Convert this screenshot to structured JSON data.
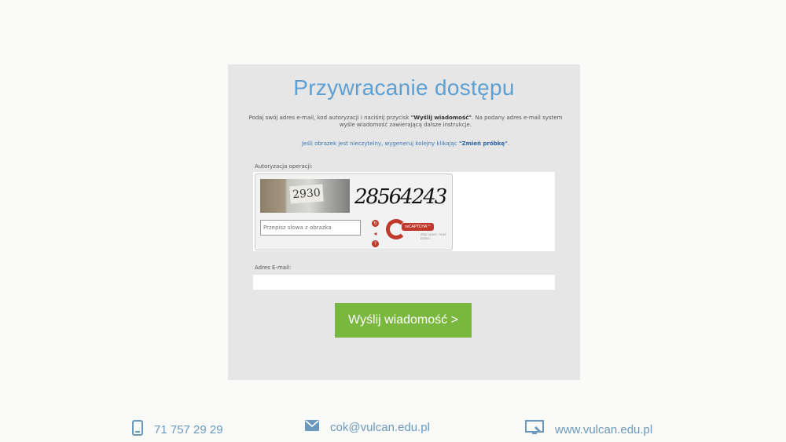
{
  "form": {
    "title": "Przywracanie dostępu",
    "instruction_prefix": "Podaj swój adres e-mail, kod autoryzacji i naciśnij przycisk ",
    "instruction_button_ref": "\"Wyślij wiadomość\"",
    "instruction_suffix": ". Na podany adres e-mail system wyśle wiadomość zawierającą dalsze instrukcje.",
    "hint_prefix": "Jeśli obrazek jest nieczytelny, wygeneruj kolejny klikając ",
    "hint_link": "\"Zmień próbkę\"",
    "hint_suffix": ".",
    "auth_label": "Autoryzacja operacji:",
    "captcha": {
      "photo_text": "2930",
      "word_text": "28564243",
      "input_placeholder": "Przepisz słowa z obrazka",
      "logo_name": "reCAPTCHA™",
      "logo_sub": "stop spam. read books."
    },
    "email_label": "Adres E-mail:",
    "email_value": "",
    "send_label": "Wyślij wiadomość >"
  },
  "footer": {
    "phone": "71 757 29 29",
    "email": "cok@vulcan.edu.pl",
    "website": "www.vulcan.edu.pl"
  },
  "colors": {
    "accent_blue": "#5ea0d3",
    "button_green": "#7ab73e",
    "recaptcha_red": "#c0392b"
  }
}
